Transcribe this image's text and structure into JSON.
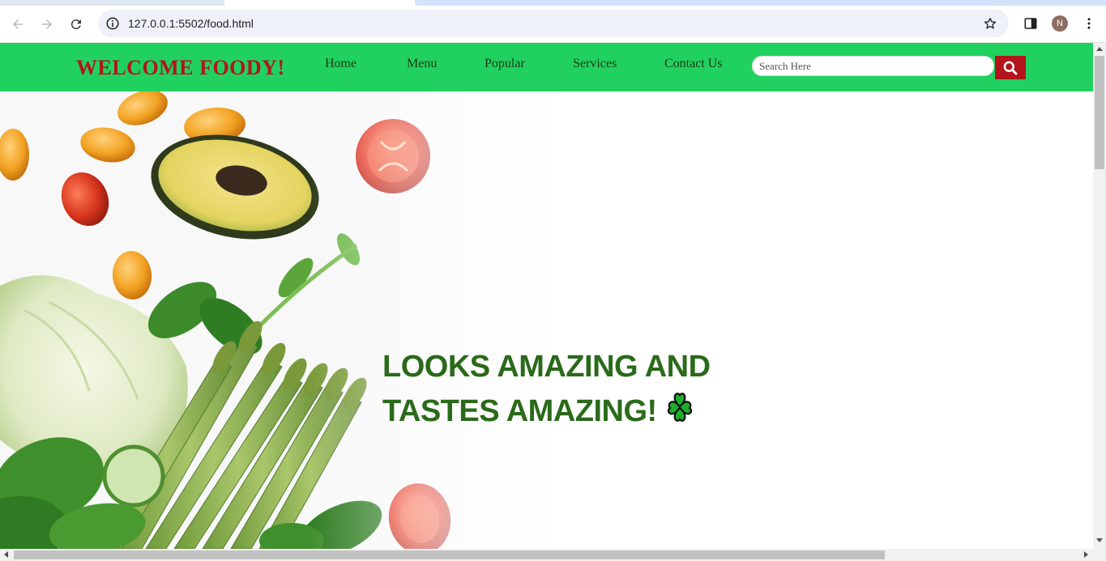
{
  "browser": {
    "url": "127.0.0.1:5502/food.html",
    "profile_initial": "N",
    "icons": [
      "back-icon",
      "forward-icon",
      "reload-icon",
      "site-info-icon",
      "bookmark-star-icon",
      "side-panel-icon",
      "menu-dots-icon"
    ]
  },
  "site": {
    "logo": "WELCOME FOODY!",
    "nav": {
      "home": "Home",
      "menu": "Menu",
      "popular": "Popular",
      "services": "Services",
      "contact": "Contact Us"
    },
    "search": {
      "placeholder": "Search Here",
      "button_icon": "search-icon"
    },
    "hero": {
      "headline_line1": "LOOKS AMAZING AND",
      "headline_line2": "TASTES AMAZING!",
      "emoji": "four-leaf-clover-icon"
    }
  },
  "colors": {
    "nav_bg": "#21d160",
    "logo": "#b3141c",
    "search_button": "#b3141c",
    "headline": "#2a6a1a"
  }
}
